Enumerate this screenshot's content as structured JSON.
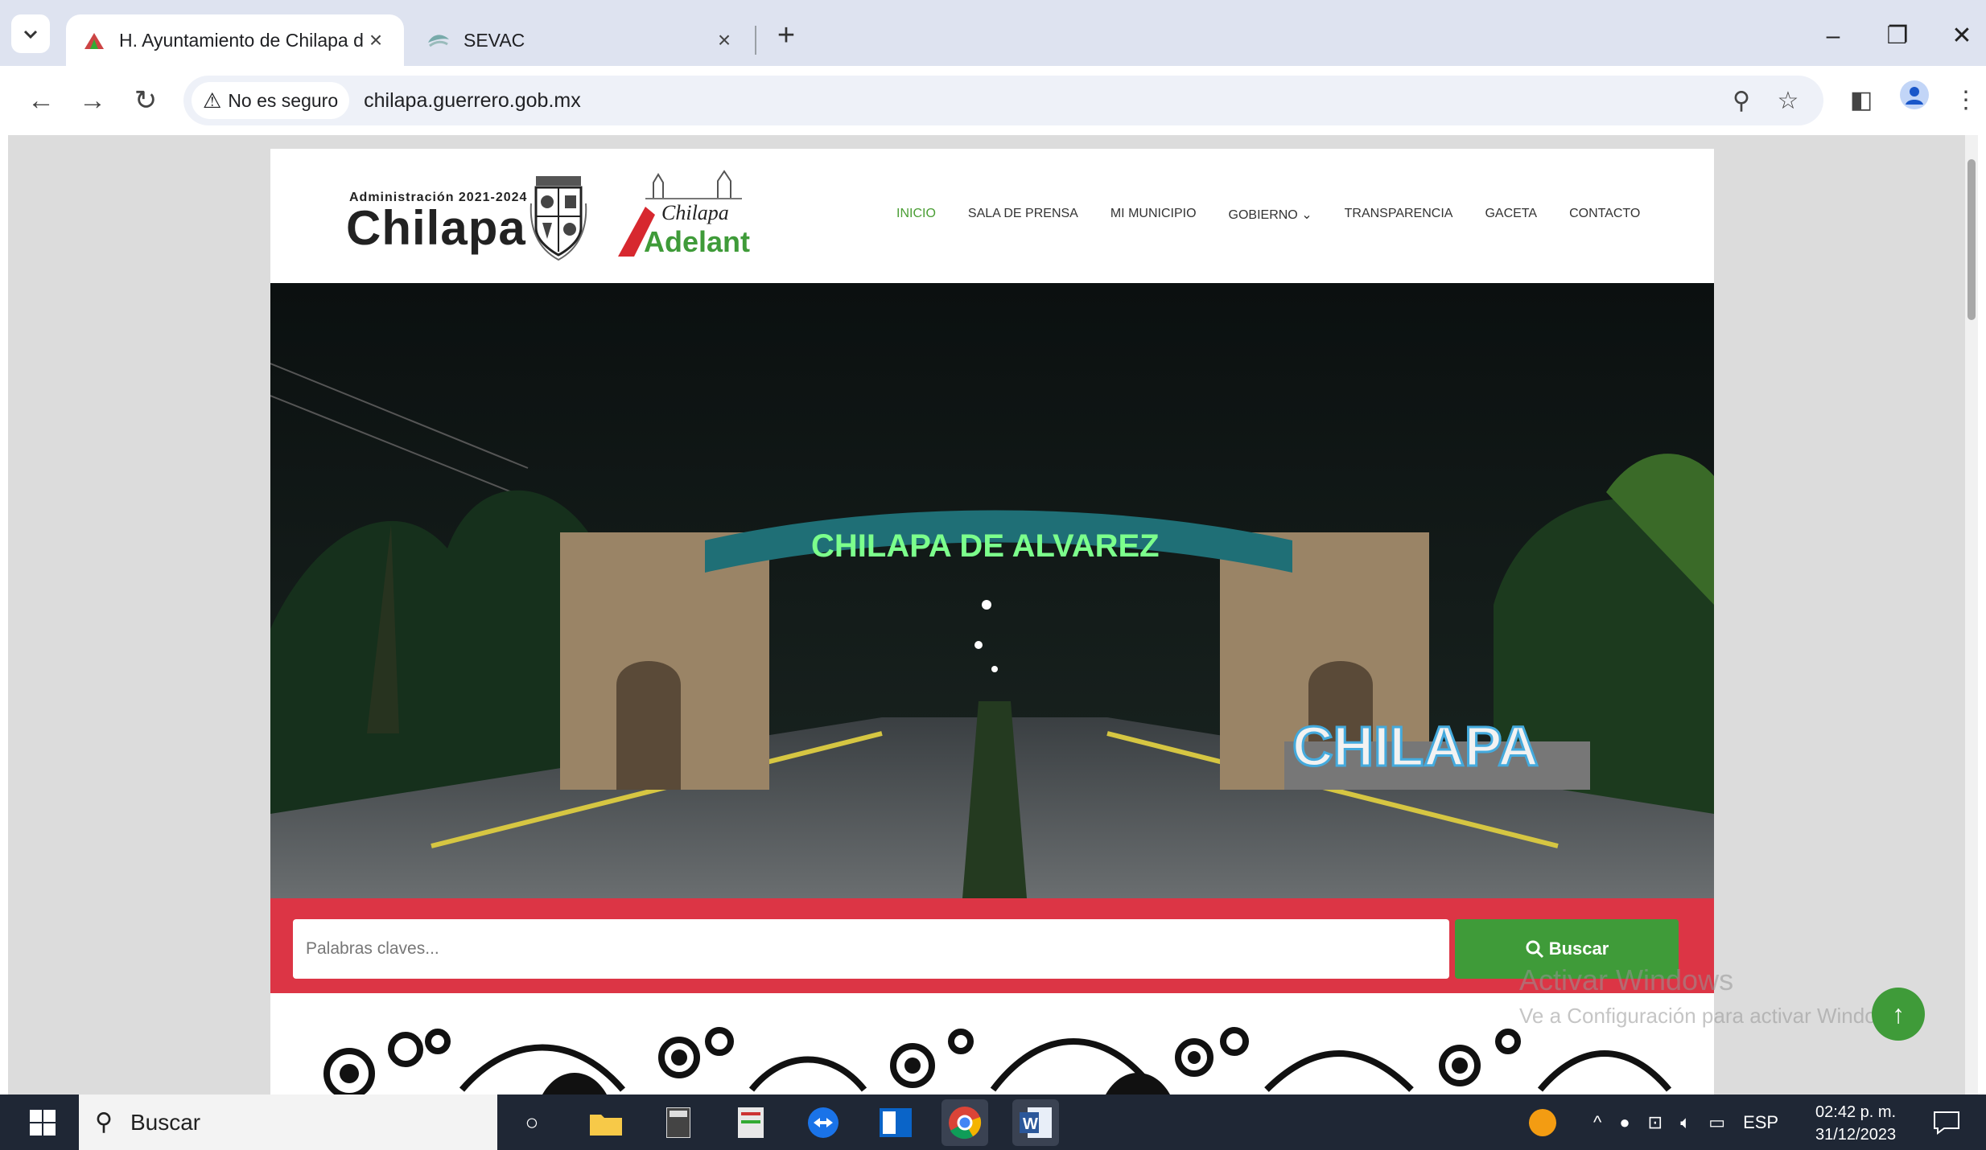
{
  "browser": {
    "tabs": [
      {
        "title": "H. Ayuntamiento de Chilapa de",
        "active": true
      },
      {
        "title": "SEVAC",
        "active": false
      }
    ],
    "security_label": "No es seguro",
    "url": "chilapa.guerrero.gob.mx"
  },
  "site": {
    "logo_admin": "Administración 2021-2024",
    "logo_name": "Chilapa",
    "slogan_top": "Chilapa",
    "slogan_bottom": "Adelante",
    "nav": [
      {
        "label": "INICIO",
        "active": true
      },
      {
        "label": "SALA DE PRENSA"
      },
      {
        "label": "MI MUNICIPIO"
      },
      {
        "label": "GOBIERNO ⌄"
      },
      {
        "label": "TRANSPARENCIA"
      },
      {
        "label": "GACETA"
      },
      {
        "label": "CONTACTO"
      }
    ],
    "hero": {
      "arch_text": "CHILAPA DE ALVAREZ",
      "letters_text": "CHILAPA"
    },
    "search": {
      "placeholder": "Palabras claves...",
      "button_label": "Buscar"
    },
    "colors": {
      "accent_green": "#3f9b39",
      "search_band": "#dc3545"
    }
  },
  "watermark": {
    "title": "Activar Windows",
    "subtitle": "Ve a Configuración para activar Windows."
  },
  "taskbar": {
    "search_label": "Buscar",
    "language": "ESP",
    "time": "02:42 p. m.",
    "date": "31/12/2023"
  }
}
